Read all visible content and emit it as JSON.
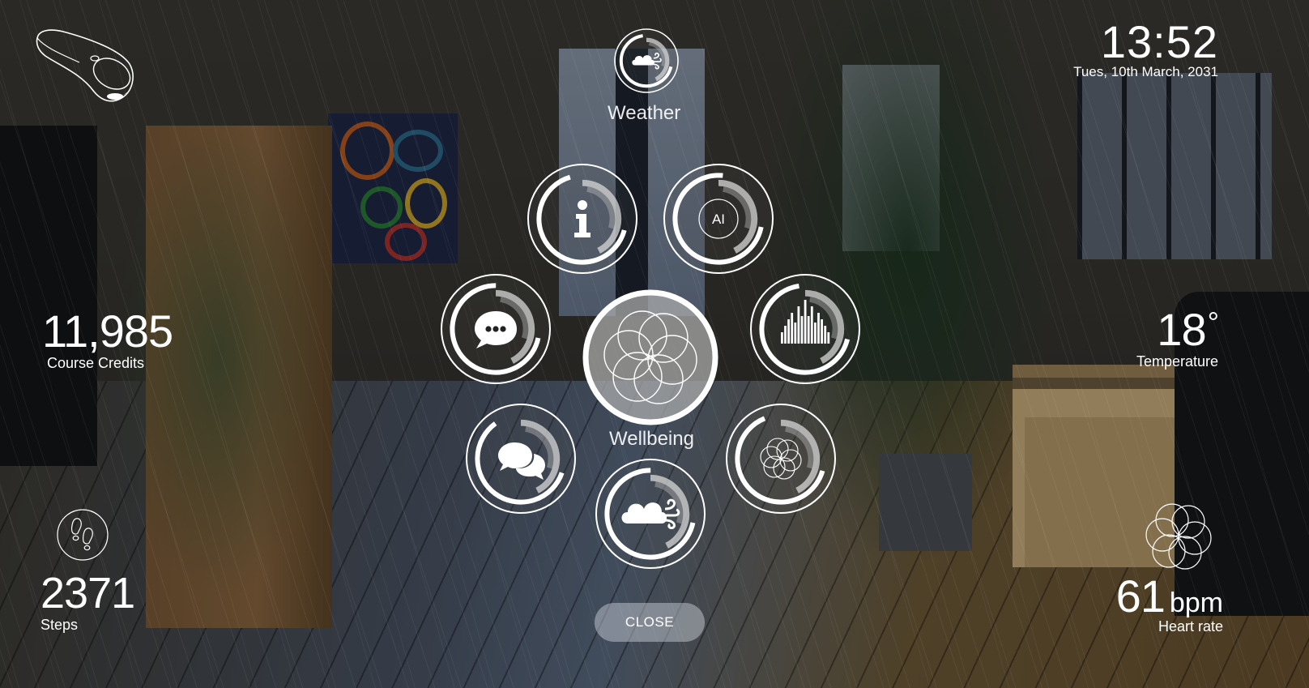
{
  "header": {
    "controller_icon": "vr-controller-icon",
    "time": "13:52",
    "date": "Tues, 10th March, 2031"
  },
  "stats": {
    "credits": {
      "value": "11,985",
      "label": "Course Credits"
    },
    "steps": {
      "value": "2371",
      "label": "Steps",
      "icon": "footprints-icon"
    },
    "temperature": {
      "value": "18",
      "unit": "°",
      "label": "Temperature"
    },
    "heart_rate": {
      "value": "61",
      "unit": "bpm",
      "label": "Heart rate",
      "icon": "flower-of-life-icon"
    }
  },
  "menu": {
    "top_item": {
      "label": "Weather",
      "icon": "cloud-wind-icon",
      "progress": 0.75
    },
    "center_item": {
      "label": "Wellbeing",
      "icon": "flower-of-life-icon"
    },
    "items": [
      {
        "id": "info",
        "icon": "info-icon",
        "progress": 0.72,
        "glyph": "i"
      },
      {
        "id": "ai",
        "icon": "ai-icon",
        "progress": 0.8,
        "glyph": "AI"
      },
      {
        "id": "chat",
        "icon": "chat-bubble-icon",
        "progress": 0.78
      },
      {
        "id": "audio",
        "icon": "sound-wave-icon",
        "progress": 0.75
      },
      {
        "id": "messages",
        "icon": "conversation-icon",
        "progress": 0.65
      },
      {
        "id": "wellbeing-mini",
        "icon": "flower-of-life-icon",
        "progress": 0.7
      },
      {
        "id": "weather-mini",
        "icon": "cloud-wind-icon",
        "progress": 0.78
      }
    ],
    "close_label": "CLOSE"
  },
  "colors": {
    "hud_white": "#ffffff",
    "arc_secondary": "#c8c8c8",
    "center_fill": "#a8a8a8"
  }
}
